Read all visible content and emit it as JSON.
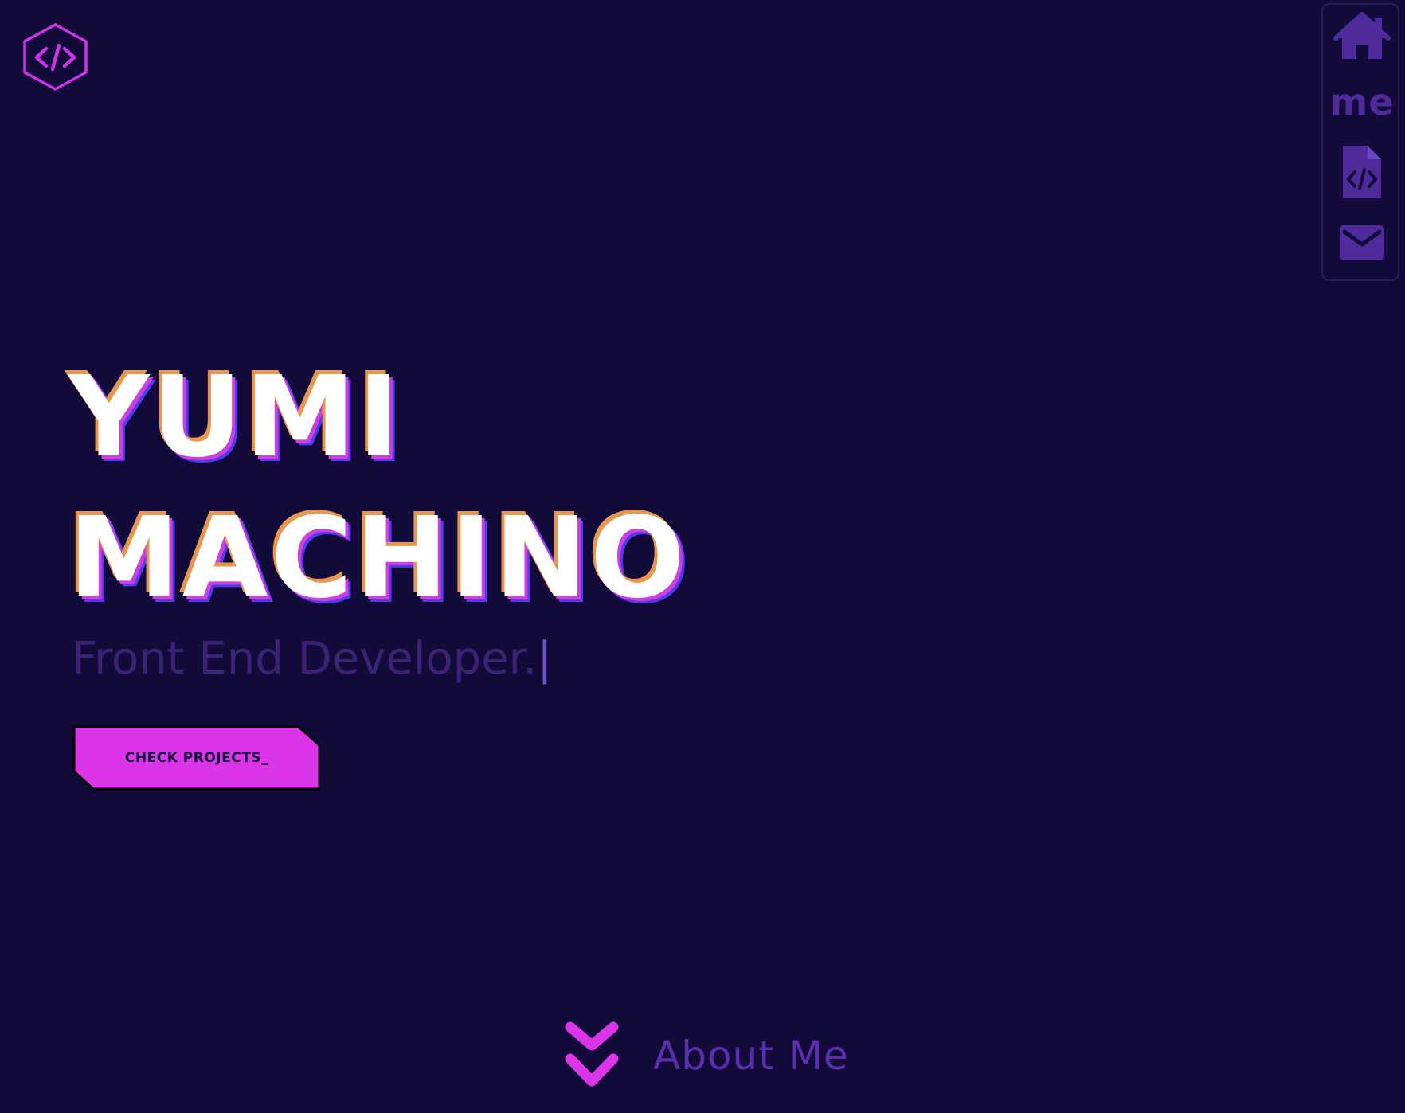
{
  "logo": {
    "icon": "code-hexagon-icon",
    "color": "#cc33e6"
  },
  "nav": {
    "items": [
      {
        "name": "home",
        "icon": "home-icon"
      },
      {
        "name": "about",
        "label": "me"
      },
      {
        "name": "projects",
        "icon": "code-file-icon"
      },
      {
        "name": "contact",
        "icon": "mail-icon"
      }
    ],
    "icon_color": "#4e2a9a"
  },
  "hero": {
    "first_name": "YUMI",
    "last_name": "MACHINO",
    "subtitle": "Front End Developer.",
    "caret": "|"
  },
  "cta": {
    "label": "CHECK PROJECTS_",
    "color": "#dc35e9"
  },
  "about_link": {
    "label": "About Me",
    "icon": "double-chevron-down-icon"
  },
  "colors": {
    "background": "#120a39",
    "accent": "#dc35e9",
    "muted_purple": "#5a2fae"
  }
}
